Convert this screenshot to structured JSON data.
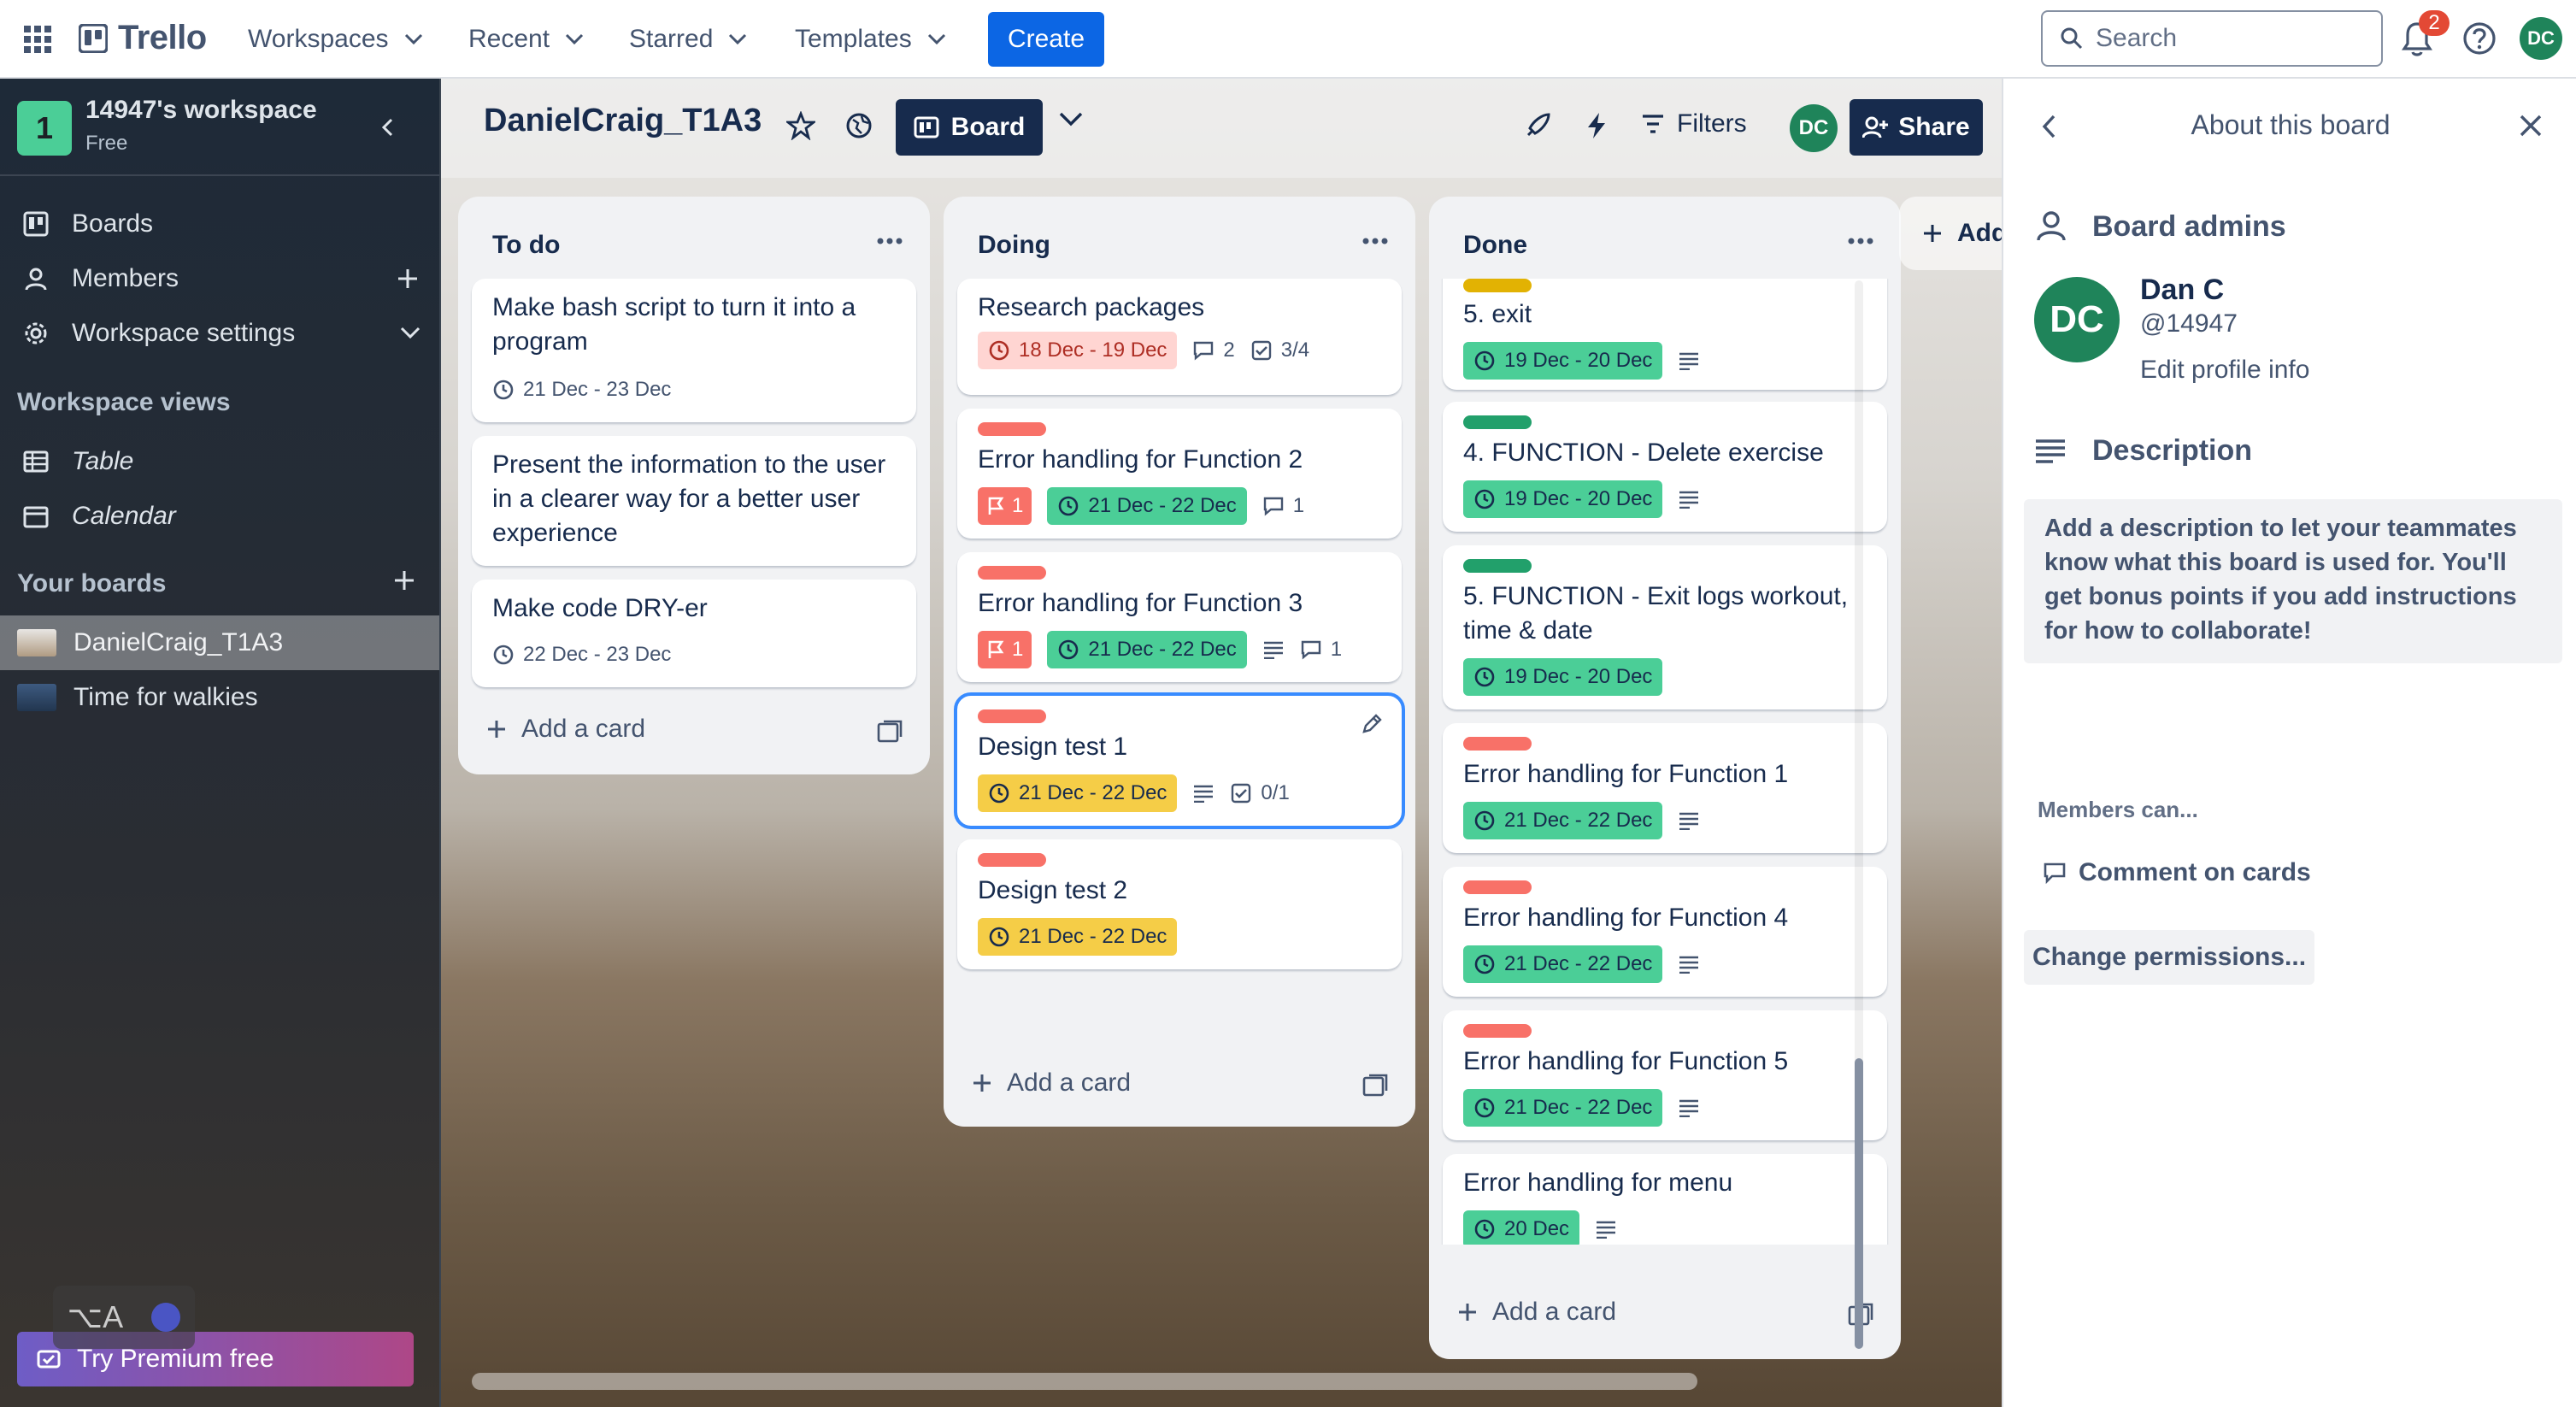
{
  "app": {
    "name": "Trello"
  },
  "nav": {
    "workspaces": "Workspaces",
    "recent": "Recent",
    "starred": "Starred",
    "templates": "Templates",
    "create": "Create",
    "search_placeholder": "Search",
    "notification_count": "2",
    "user_initials": "DC"
  },
  "sidebar": {
    "workspace_initial": "1",
    "workspace_name": "14947's workspace",
    "workspace_plan": "Free",
    "items": [
      {
        "label": "Boards"
      },
      {
        "label": "Members"
      },
      {
        "label": "Workspace settings"
      }
    ],
    "views_heading": "Workspace views",
    "views": [
      {
        "label": "Table"
      },
      {
        "label": "Calendar"
      }
    ],
    "boards_heading": "Your boards",
    "boards": [
      {
        "label": "DanielCraig_T1A3"
      },
      {
        "label": "Time for walkies"
      }
    ],
    "premium": "Try Premium free"
  },
  "board": {
    "title": "DanielCraig_T1A3",
    "view_label": "Board",
    "filters": "Filters",
    "member_initials": "DC",
    "share": "Share",
    "add_list": "Add",
    "add_card": "Add a card"
  },
  "lists": [
    {
      "title": "To do",
      "cards": [
        {
          "title": "Make bash script to turn it into a program",
          "date": "21 Dec - 23 Dec"
        },
        {
          "title": "Present the information to the user in a clearer way for a better user experience"
        },
        {
          "title": "Make code DRY-er",
          "date": "22 Dec - 23 Dec"
        }
      ]
    },
    {
      "title": "Doing",
      "cards": [
        {
          "title": "Research packages",
          "date": "18 Dec - 19 Dec",
          "comments": "2",
          "checklist": "3/4"
        },
        {
          "title": "Error handling for Function 2",
          "votes": "1",
          "date": "21 Dec - 22 Dec",
          "comments": "1",
          "label": "#f87168"
        },
        {
          "title": "Error handling for Function 3",
          "votes": "1",
          "date": "21 Dec - 22 Dec",
          "comments": "1",
          "label": "#f87168"
        },
        {
          "title": "Design test 1",
          "date": "21 Dec - 22 Dec",
          "checklist": "0/1",
          "label": "#f87168"
        },
        {
          "title": "Design test 2",
          "date": "21 Dec - 22 Dec",
          "label": "#f87168"
        }
      ]
    },
    {
      "title": "Done",
      "cards": [
        {
          "title": "5. exit",
          "date": "19 Dec - 20 Dec",
          "label": "#e2b203"
        },
        {
          "title": "4. FUNCTION - Delete exercise",
          "date": "19 Dec - 20 Dec",
          "label": "#22a06b"
        },
        {
          "title": "5. FUNCTION - Exit logs workout, time & date",
          "date": "19 Dec - 20 Dec",
          "label": "#22a06b"
        },
        {
          "title": "Error handling for Function 1",
          "date": "21 Dec - 22 Dec",
          "label": "#f87168"
        },
        {
          "title": "Error handling for Function 4",
          "date": "21 Dec - 22 Dec",
          "label": "#f87168"
        },
        {
          "title": "Error handling for Function 5",
          "date": "21 Dec - 22 Dec",
          "label": "#f87168"
        },
        {
          "title": "Error handling for menu",
          "date": "20 Dec"
        }
      ]
    }
  ],
  "panel": {
    "title": "About this board",
    "admins_heading": "Board admins",
    "admin_initials": "DC",
    "admin_name": "Dan C",
    "admin_handle": "@14947",
    "edit_profile": "Edit profile info",
    "description_heading": "Description",
    "description_text": "Add a description to let your teammates know what this board is used for. You'll get bonus points if you add instructions for how to collaborate!",
    "members_can": "Members can...",
    "comment_option": "Comment on cards",
    "change_permissions": "Change permissions..."
  },
  "colors": {
    "primary": "#0c66e4",
    "label_red": "#f87168",
    "label_green": "#22a06b",
    "label_yellow": "#e2b203",
    "date_green": "#4bce97",
    "date_yellow": "#f5cd47"
  }
}
